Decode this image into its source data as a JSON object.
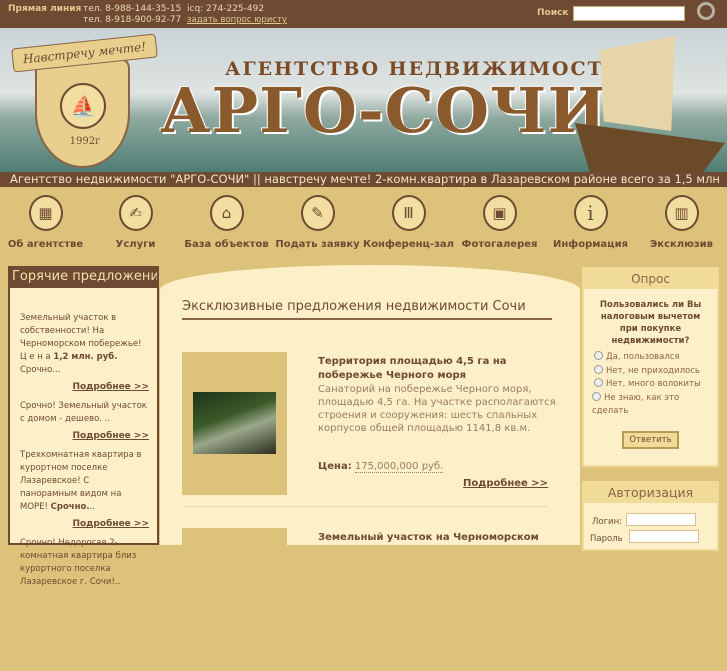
{
  "topbar": {
    "hotline_label": "Прямая линия",
    "phone1": "тел. 8-988-144-35-15",
    "phone2": "тел. 8-918-900-92-77",
    "icq": "icq: 274-225-492",
    "ask_lawyer": "задать вопрос юристу",
    "search_label": "Поиск",
    "search_value": ""
  },
  "banner": {
    "motto": "Навстречу мечте!",
    "year": "1992г",
    "subtitle": "АГЕНТСТВО НЕДВИЖИМОСТИ",
    "brand": "АРГО-СОЧИ"
  },
  "ticker": "Агентство недвижимости \"АРГО-СОЧИ\" || навстречу мечте! 2-комн.квартира в Лазаревском районе всего за 1,5 млн",
  "nav": [
    {
      "label": "Об агентстве",
      "icon": "buildings-icon"
    },
    {
      "label": "Услуги",
      "icon": "handshake-icon"
    },
    {
      "label": "База объектов",
      "icon": "house-icon"
    },
    {
      "label": "Подать заявку",
      "icon": "document-pen-icon"
    },
    {
      "label": "Конференц-зал",
      "icon": "columns-icon"
    },
    {
      "label": "Фотогалерея",
      "icon": "photos-icon"
    },
    {
      "label": "Информация",
      "icon": "info-icon"
    },
    {
      "label": "Эксклюзив",
      "icon": "villa-icon"
    }
  ],
  "hot": {
    "title": "Горячие предложения",
    "more": "Подробнее >>",
    "items": [
      {
        "text": "Земельный участок в собственности! На Черноморском побережье! Ц е н а ",
        "bold": "1,2 млн. руб.",
        "tail": " Срочно..."
      },
      {
        "text": "Срочно! Земельный участок с домом - дешево. ..",
        "bold": "",
        "tail": ""
      },
      {
        "text": "Трехкомнатная квартира в курортном поселке Лазаревское! С панорамным видом на МОРЕ! ",
        "bold": "Срочно.",
        "tail": ".."
      },
      {
        "text": "Срочно! Недорогая 2-комнатная квартира близ курортного поселка Лазаревское г. Сочи!..",
        "bold": "",
        "tail": ""
      }
    ]
  },
  "main": {
    "title": "Эксклюзивные предложения недвижимости Сочи",
    "items": [
      {
        "title": "Территория площадью 4,5 га на побережье Черного моря",
        "desc": "Санаторий на побережье Черного моря, площадью 4,5 га. На участке располагаются строения и сооружения: шесть спальных корпусов общей площадью 1141,8 кв.м.",
        "price_label": "Цена:",
        "price": "175,000,000 руб.",
        "more": "Подробнее >>"
      },
      {
        "title": "Земельный участок на Черноморском"
      }
    ]
  },
  "poll": {
    "title": "Опрос",
    "question": "Пользовались ли Вы налоговым вычетом при покупке недвижимости?",
    "options": [
      "Да, пользовался",
      "Нет, не приходилось",
      "Нет, много волокиты",
      "Не знаю, как это сделать"
    ],
    "submit": "Ответить"
  },
  "auth": {
    "title": "Авторизация",
    "login_label": "Логин:",
    "password_label": "Пароль"
  }
}
